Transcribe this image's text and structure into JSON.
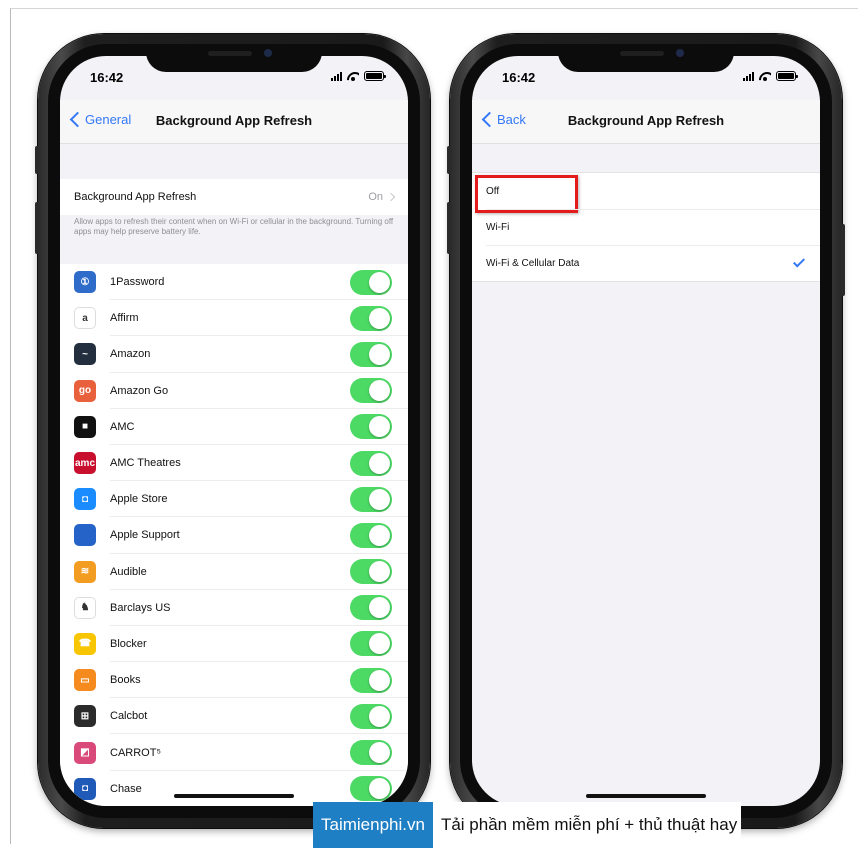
{
  "left_phone": {
    "time": "16:42",
    "back_label": "General",
    "title": "Background App Refresh",
    "master_label": "Background App Refresh",
    "master_value": "On",
    "footer": "Allow apps to refresh their content when on Wi-Fi or cellular in the background. Turning off apps may help preserve battery life.",
    "apps": [
      {
        "name": "1Password",
        "glyph": "①",
        "color": "#2f6bc9",
        "enabled": true
      },
      {
        "name": "Affirm",
        "glyph": "a",
        "color": "#ffffff",
        "enabled": true
      },
      {
        "name": "Amazon",
        "glyph": "~",
        "color": "#232f3e",
        "enabled": true
      },
      {
        "name": "Amazon Go",
        "glyph": "go",
        "color": "#e8603c",
        "enabled": true
      },
      {
        "name": "AMC",
        "glyph": "■",
        "color": "#111111",
        "enabled": true
      },
      {
        "name": "AMC Theatres",
        "glyph": "amc",
        "color": "#c8102e",
        "enabled": true
      },
      {
        "name": "Apple Store",
        "glyph": "◘",
        "color": "#1a8cff",
        "enabled": true
      },
      {
        "name": "Apple Support",
        "glyph": "",
        "color": "#2563c9",
        "enabled": true
      },
      {
        "name": "Audible",
        "glyph": "≋",
        "color": "#f39c22",
        "enabled": true
      },
      {
        "name": "Barclays US",
        "glyph": "♞",
        "color": "#ffffff",
        "enabled": true
      },
      {
        "name": "Blocker",
        "glyph": "☎",
        "color": "#f7c600",
        "enabled": true
      },
      {
        "name": "Books",
        "glyph": "▭",
        "color": "#f58a1f",
        "enabled": true
      },
      {
        "name": "Calcbot",
        "glyph": "⊞",
        "color": "#2b2b2b",
        "enabled": true
      },
      {
        "name": "CARROT⁵",
        "glyph": "◩",
        "color": "#d94a7a",
        "enabled": true
      },
      {
        "name": "Chase",
        "glyph": "◘",
        "color": "#1f5ab8",
        "enabled": true
      }
    ]
  },
  "right_phone": {
    "time": "16:42",
    "back_label": "Back",
    "title": "Background App Refresh",
    "options": [
      {
        "label": "Off",
        "selected": false
      },
      {
        "label": "Wi-Fi",
        "selected": false
      },
      {
        "label": "Wi-Fi & Cellular Data",
        "selected": true
      }
    ]
  },
  "watermark": {
    "brand": "Taimienphi.vn",
    "tagline": "Tải phần mềm miễn phí + thủ thuật hay"
  },
  "colors": {
    "ios_blue": "#3478f6",
    "toggle_green": "#4cd964",
    "highlight_red": "#e31b1b",
    "brand_blue": "#1e7fc4"
  }
}
